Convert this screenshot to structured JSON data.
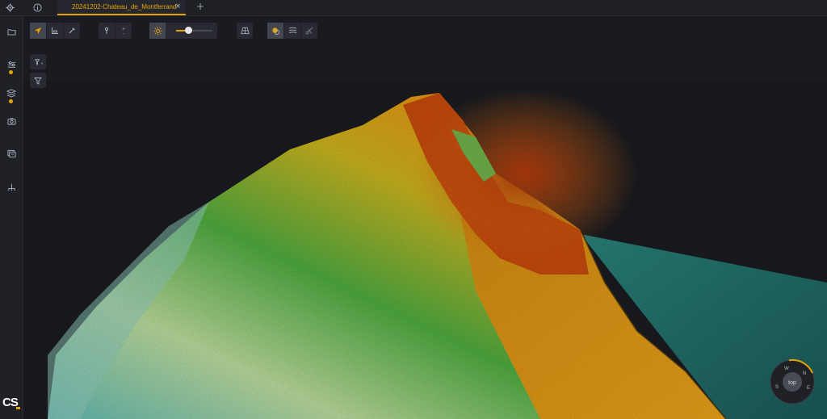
{
  "topbar": {
    "tab_label": "20241202-Chateau_de_Montferrand",
    "close_glyph": "×",
    "add_glyph": "+",
    "icons": [
      "gear-icon",
      "info-icon"
    ]
  },
  "sidebar": {
    "icons": [
      "folder-icon",
      "sliders-icon",
      "layers-icon",
      "camera-icon",
      "gallery-icon",
      "network-icon"
    ],
    "logo_text": "CS"
  },
  "toolbar": {
    "slider_value": 0.35,
    "icons": [
      "navigate-icon",
      "measure-icon",
      "pick-icon",
      "pin-icon",
      "zoom-step-icon",
      "sun-icon",
      "grid-view-icon",
      "point-cloud-icon",
      "contour-icon",
      "scissors-icon"
    ]
  },
  "compass": {
    "center_label": "top",
    "labels": [
      "W",
      "N",
      "E",
      "S"
    ]
  },
  "colors": {
    "accent": "#e6a400",
    "background": "#17181c",
    "panel": "#202127"
  }
}
